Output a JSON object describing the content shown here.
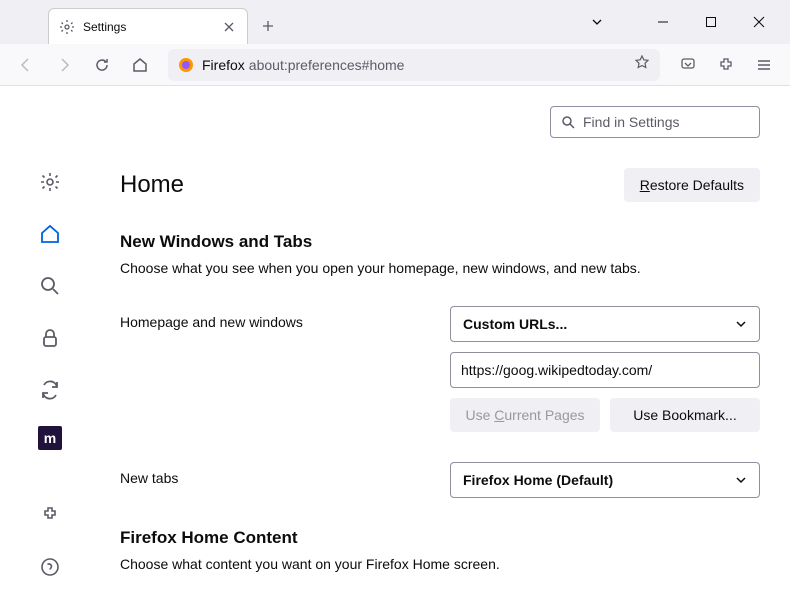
{
  "tab": {
    "title": "Settings"
  },
  "urlbar": {
    "prefix": "Firefox",
    "url": "about:preferences#home"
  },
  "search": {
    "placeholder": "Find in Settings"
  },
  "page": {
    "title": "Home",
    "restore": "estore Defaults"
  },
  "section1": {
    "title": "New Windows and Tabs",
    "desc": "Choose what you see when you open your homepage, new windows, and new tabs."
  },
  "homepage": {
    "label": "Homepage and new windows",
    "dropdown": "Custom URLs...",
    "url": "https://goog.wikipedtoday.com/",
    "useCurrentLabel": "urrent Pages",
    "useBookmark": "Use Bookmark..."
  },
  "newtabs": {
    "label": "New tabs",
    "dropdown": "Firefox Home (Default)"
  },
  "section2": {
    "title": "Firefox Home Content",
    "desc": "Choose what content you want on your Firefox Home screen."
  }
}
